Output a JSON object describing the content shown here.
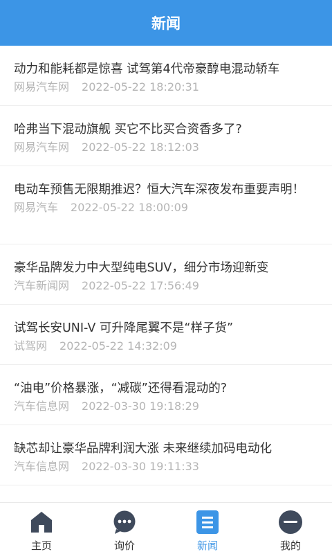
{
  "header": {
    "title": "新闻"
  },
  "news": [
    {
      "title": "动力和能耗都是惊喜 试驾第4代帝豪醇电混动轿车",
      "source": "网易汽车网",
      "time": "2022-05-22 18:20:31"
    },
    {
      "title": "哈弗当下混动旗舰 买它不比买合资香多了?",
      "source": "网易汽车网",
      "time": "2022-05-22 18:12:03"
    },
    {
      "title": "电动车预售无限期推迟？恒大汽车深夜发布重要声明！",
      "source": "网易汽车",
      "time": "2022-05-22 18:00:09"
    },
    {
      "title": "豪华品牌发力中大型纯电SUV，细分市场迎新变",
      "source": "汽车新闻网",
      "time": "2022-05-22 17:56:49"
    },
    {
      "title": "试驾长安UNI-V 可升降尾翼不是“样子货”",
      "source": "试驾网",
      "time": "2022-05-22 14:32:09"
    },
    {
      "title": "“油电”价格暴涨，“减碳”还得看混动的?",
      "source": "汽车信息网",
      "time": "2022-03-30 19:18:29"
    },
    {
      "title": "缺芯却让豪华品牌利润大涨 未来继续加码电动化",
      "source": "汽车信息网",
      "time": "2022-03-30 19:11:33"
    },
    {
      "title": "",
      "source": "",
      "time": ""
    }
  ],
  "tabbar": {
    "items": [
      {
        "label": "主页",
        "icon": "home-icon"
      },
      {
        "label": "询价",
        "icon": "chat-icon"
      },
      {
        "label": "新闻",
        "icon": "news-icon"
      },
      {
        "label": "我的",
        "icon": "profile-icon"
      }
    ],
    "active_index": 2
  },
  "colors": {
    "accent": "#3c95e6",
    "icon_dark": "#3f4a5c",
    "meta_text": "#b5b5b5"
  }
}
